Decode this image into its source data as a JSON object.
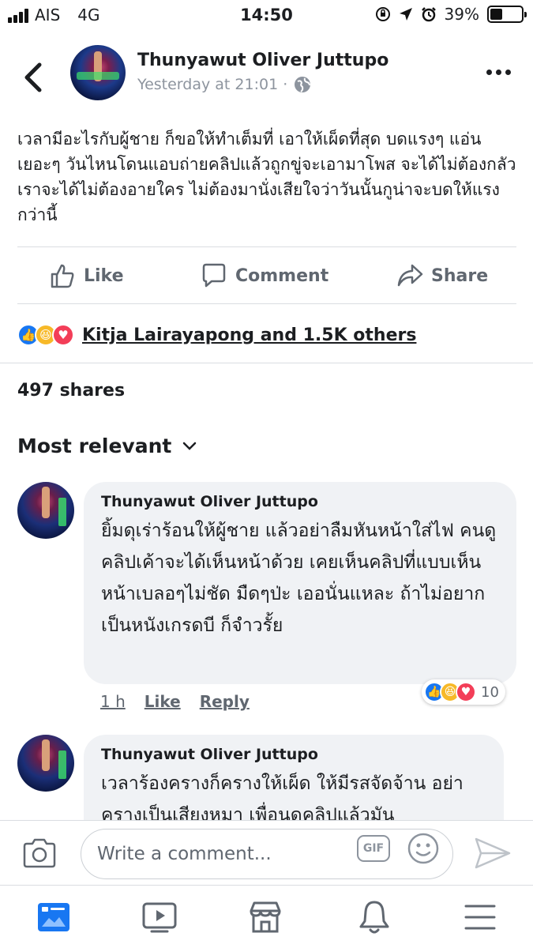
{
  "status_bar": {
    "carrier": "AIS",
    "network": "4G",
    "time": "14:50",
    "battery": "39%",
    "battery_level": 0.39
  },
  "post": {
    "author": "Thunyawut Oliver Juttupo",
    "timestamp": "Yesterday at 21:01 ·",
    "text": "เวลามีอะไรกับผู้ชาย ก็ขอให้ทำเต็มที่ เอาให้เผ็ดที่สุด บดแรงๆ แอ่นเยอะๆ วันไหนโดนแอบถ่ายคลิปแล้วถูกขู่จะเอามาโพส จะได้ไม่ต้องกลัว เราจะได้ไม่ต้องอายใคร ไม่ต้องมานั่งเสียใจว่าวันนั้นกูน่าจะบดให้แรงกว่านี้",
    "actions": {
      "like": "Like",
      "comment": "Comment",
      "share": "Share"
    },
    "reactions_summary": "Kitja Lairayapong and 1.5K others",
    "shares": "497 shares"
  },
  "comments_section": {
    "sort_label": "Most relevant",
    "comments": [
      {
        "author": "Thunyawut Oliver Juttupo",
        "text": "ยิ้มดุเร่าร้อนให้ผู้ชาย แล้วอย่าลืมหันหน้าใส่ไฟ คนดูคลิปเค้าจะได้เห็นหน้าด้วย เคยเห็นคลิปที่แบบเห็นหน้าเบลอๆไม่ชัด มืดๆป่ะ เออนั่นแหละ ถ้าไม่อยากเป็นหนังเกรดบี ก็จำวรั้ย",
        "time": "1 h",
        "like": "Like",
        "reply": "Reply",
        "reaction_count": "10"
      },
      {
        "author": "Thunyawut Oliver Juttupo",
        "text": "เวลาร้องครางก็ครางให้เผ็ด ให้มีรสจัดจ้าน อย่าครางเป็นเสียงหมา เพื่อนดูคลิปแล้วมัน"
      }
    ]
  },
  "composer": {
    "placeholder": "Write a comment...",
    "gif_label": "GIF"
  },
  "icons": {
    "back": "chevron-left-icon",
    "more": "more-horizontal-icon",
    "globe": "globe-icon",
    "camera": "camera-icon",
    "emoji": "emoji-icon",
    "send": "send-icon",
    "tabs": [
      "news-feed-icon",
      "watch-icon",
      "marketplace-icon",
      "notifications-icon",
      "menu-icon"
    ]
  },
  "colors": {
    "accent": "#1877f2",
    "haha": "#f7b928",
    "love": "#f33e58"
  }
}
